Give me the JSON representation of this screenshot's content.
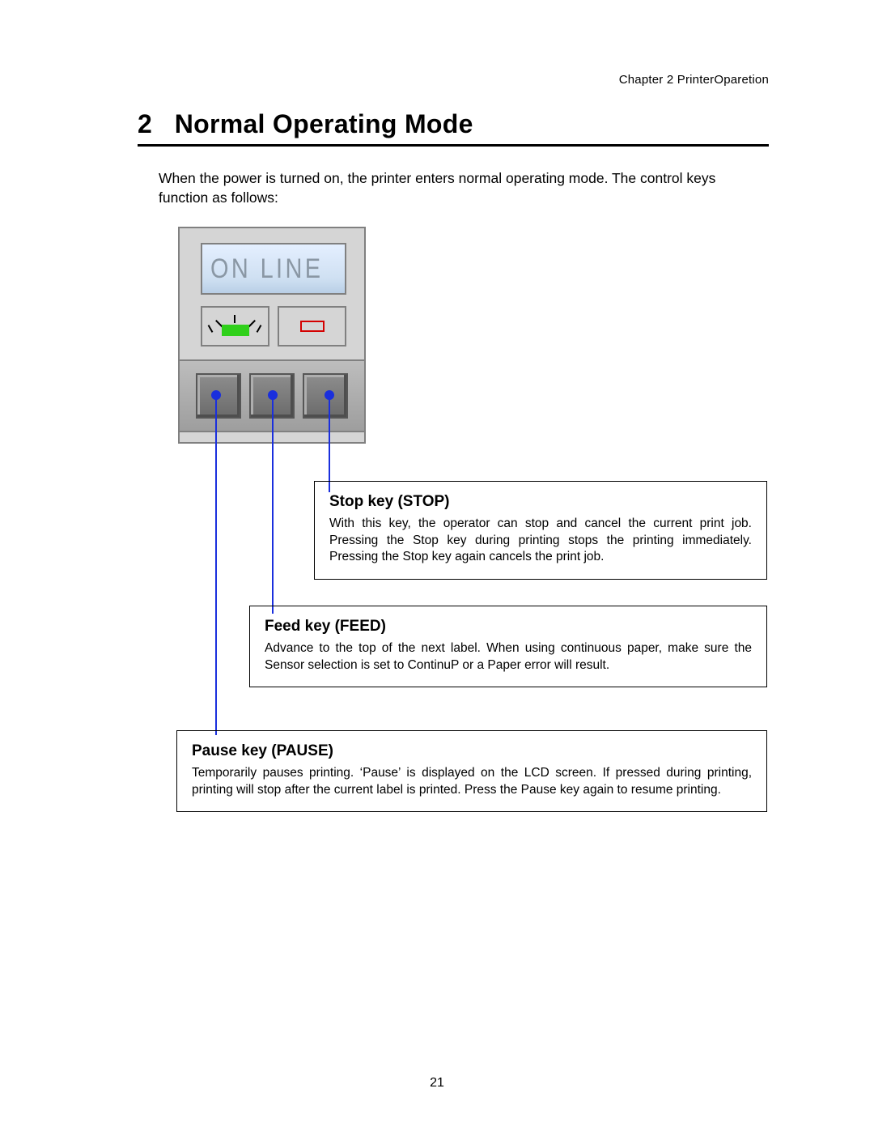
{
  "header": {
    "chapter": "Chapter 2   PrinterOparetion"
  },
  "section": {
    "number": "2",
    "title": "Normal Operating Mode"
  },
  "intro": "When the power is turned on, the printer enters normal operating mode. The control keys function as follows:",
  "panel": {
    "lcd_text": "ON LINE"
  },
  "callouts": {
    "stop": {
      "title": "Stop key (STOP)",
      "body": "With this key, the operator can stop and cancel the current print job. Pressing the Stop key during printing stops the printing immediately. Pressing the Stop key again cancels the print job."
    },
    "feed": {
      "title": "Feed key (FEED)",
      "body": "Advance to the top of the next label. When using continuous paper, make sure the Sensor selection is set to ContinuP or a Paper error will result."
    },
    "pause": {
      "title": "Pause key (PAUSE)",
      "body": "Temporarily pauses printing. ‘Pause’ is displayed on the LCD screen. If pressed during printing, printing will stop after the current label is printed. Press the Pause key again to resume printing."
    }
  },
  "page_number": "21"
}
